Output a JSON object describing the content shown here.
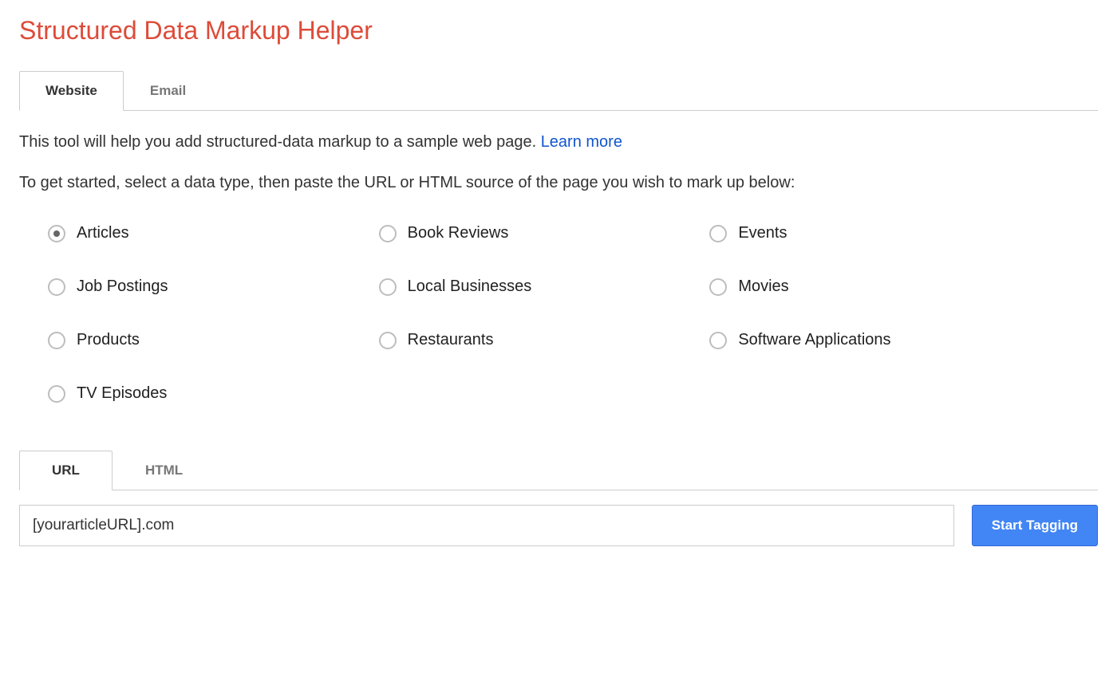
{
  "header": {
    "title": "Structured Data Markup Helper"
  },
  "source_tabs": {
    "items": [
      {
        "label": "Website",
        "active": true
      },
      {
        "label": "Email",
        "active": false
      }
    ]
  },
  "intro": {
    "text_before_link": "This tool will help you add structured-data markup to a sample web page. ",
    "link_text": "Learn more"
  },
  "instructions": "To get started, select a data type, then paste the URL or HTML source of the page you wish to mark up below:",
  "data_types": [
    {
      "label": "Articles",
      "checked": true
    },
    {
      "label": "Book Reviews",
      "checked": false
    },
    {
      "label": "Events",
      "checked": false
    },
    {
      "label": "Job Postings",
      "checked": false
    },
    {
      "label": "Local Businesses",
      "checked": false
    },
    {
      "label": "Movies",
      "checked": false
    },
    {
      "label": "Products",
      "checked": false
    },
    {
      "label": "Restaurants",
      "checked": false
    },
    {
      "label": "Software Applications",
      "checked": false
    },
    {
      "label": "TV Episodes",
      "checked": false
    }
  ],
  "input_tabs": {
    "items": [
      {
        "label": "URL",
        "active": true
      },
      {
        "label": "HTML",
        "active": false
      }
    ]
  },
  "url_field": {
    "value": "[yourarticleURL].com"
  },
  "actions": {
    "start_tagging": "Start Tagging"
  }
}
